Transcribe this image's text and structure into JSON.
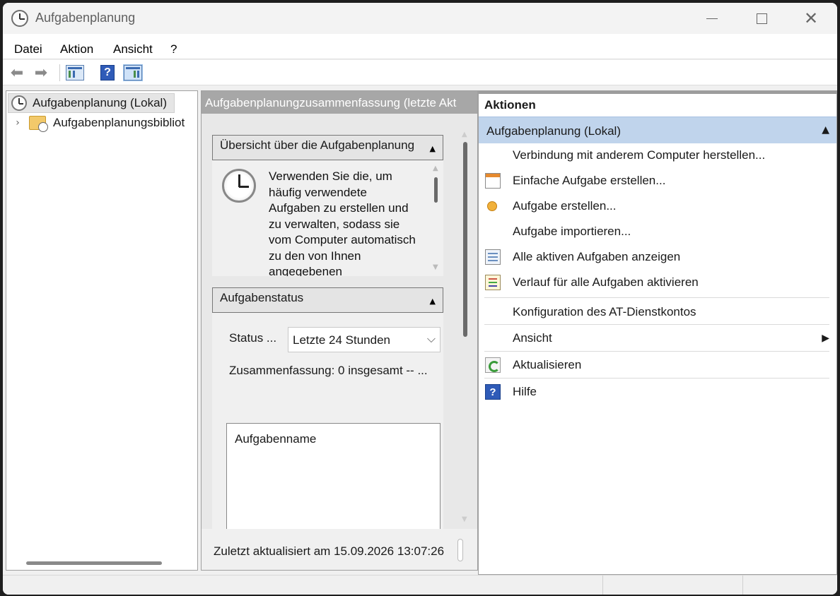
{
  "window": {
    "title": "Aufgabenplanung",
    "controls": {
      "minimize": "—",
      "maximize": "☐",
      "close": "✕"
    }
  },
  "menu": [
    "Datei",
    "Aktion",
    "Ansicht",
    "?"
  ],
  "toolbar": {
    "icons": [
      "back-arrow-icon",
      "forward-arrow-icon",
      "show-hide-console-tree-icon",
      "help-icon",
      "show-hide-action-pane-icon"
    ],
    "help_glyph": "?"
  },
  "tree": {
    "root": "Aufgabenplanung (Lokal)",
    "child": "Aufgabenplanungsbibliot",
    "expander": "›"
  },
  "middle": {
    "header": "Aufgabenplanungzusammenfassung (letzte Akt",
    "overview": {
      "title": "Übersicht über die Aufgabenplanung",
      "description": "Verwenden Sie die, um häufig verwendete Aufgaben zu erstellen und zu verwalten, sodass sie vom Computer automatisch zu den von Ihnen angegebenen"
    },
    "task_status": {
      "title": "Aufgabenstatus",
      "status_label": "Status ...",
      "status_value": "Letzte 24 Stunden",
      "summary": "Zusammenfassung: 0 insgesamt -- ...",
      "column_header": "Aufgabenname"
    },
    "footer": "Zuletzt aktualisiert am 15.09.2026 13:07:26",
    "collapse_glyph": "▲",
    "caret_glyph": "⌵"
  },
  "actions": {
    "title": "Aktionen",
    "group": "Aufgabenplanung (Lokal)",
    "group_glyph": "▲",
    "submenu_glyph": "▶",
    "items": [
      {
        "label": "Verbindung mit anderem Computer herstellen...",
        "icon": ""
      },
      {
        "label": "Einfache Aufgabe erstellen...",
        "icon": "calendar-clock-icon"
      },
      {
        "label": "Aufgabe erstellen...",
        "icon": "create-task-icon"
      },
      {
        "label": "Aufgabe importieren...",
        "icon": ""
      },
      {
        "label": "Alle aktiven Aufgaben anzeigen",
        "icon": "task-list-icon"
      },
      {
        "label": "Verlauf für alle Aufgaben aktivieren",
        "icon": "history-icon"
      },
      {
        "label": "Konfiguration des AT-Dienstkontos",
        "icon": ""
      },
      {
        "label": "Ansicht",
        "icon": ""
      },
      {
        "label": "Aktualisieren",
        "icon": "refresh-icon"
      },
      {
        "label": "Hilfe",
        "icon": "help-icon"
      }
    ]
  }
}
